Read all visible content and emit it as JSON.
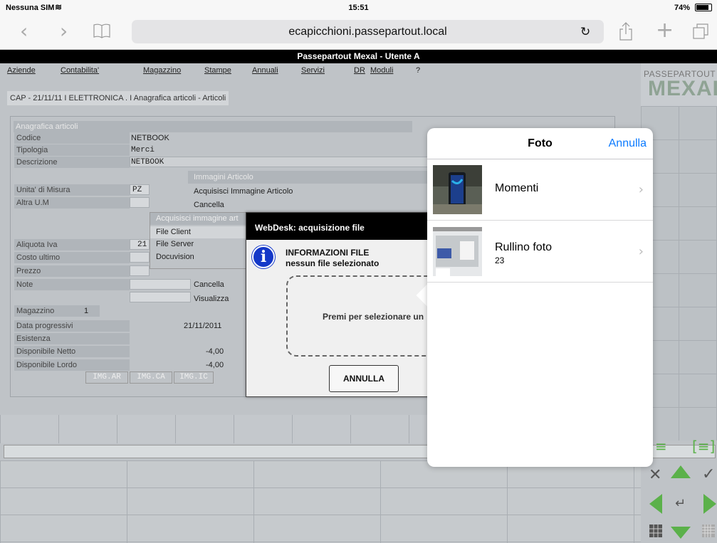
{
  "status": {
    "carrier": "Nessuna SIM",
    "time": "15:51",
    "battery": "74%"
  },
  "safari": {
    "url": "ecapicchioni.passepartout.local"
  },
  "app": {
    "title": "Passepartout Mexal - Utente A",
    "logo_top": "PASSEPARTOUT",
    "logo_bottom": "MEXAL"
  },
  "menu": [
    {
      "label": "Aziende"
    },
    {
      "label": "Contabilita'"
    },
    {
      "label": "Magazzino"
    },
    {
      "label": "Stampe"
    },
    {
      "label": "Annuali"
    },
    {
      "label": "Servizi"
    },
    {
      "label": "DR"
    },
    {
      "label": "Moduli"
    },
    {
      "label": "?"
    }
  ],
  "breadcrumb": "CAP - 21/11/11 I ELETTRONICA . I Anagrafica articoli - Articoli",
  "form": {
    "title": "Anagrafica articoli",
    "codice_label": "Codice",
    "codice": "NETBOOK",
    "tipologia_label": "Tipologia",
    "tipologia": "Merci",
    "descrizione_label": "Descrizione",
    "descrizione": "NETBOOK",
    "um_label": "Unita' di Misura",
    "um": "PZ",
    "altra_um_label": "Altra U.M",
    "aliquota_label": "Aliquota Iva",
    "aliquota": "21",
    "costo_label": "Costo ultimo",
    "prezzo_label": "Prezzo",
    "note_label": "Note",
    "magazzino_label": "Magazzino",
    "magazzino": "1",
    "data_prog_label": "Data progressivi",
    "data_prog": "21/11/2011",
    "esistenza_label": "Esistenza",
    "disp_netto_label": "Disponibile Netto",
    "disp_netto": "-4,00",
    "disp_lordo_label": "Disponibile Lordo",
    "disp_lordo": "-4,00",
    "img_buttons": [
      "IMG.AR",
      "IMG.CA",
      "IMG.IC"
    ]
  },
  "immagini": {
    "title": "Immagini Articolo",
    "acquisisci": "Acquisisci Immagine Articolo",
    "cancella": "Cancella",
    "cancella2": "Cancella",
    "visualizza": "Visualizza"
  },
  "submenu": {
    "title": "Acquisisci immagine art",
    "items": [
      "File Client",
      "File Server",
      "Docuvision"
    ]
  },
  "webdesk": {
    "title": "WebDesk: acquisizione file",
    "info1": "INFORMAZIONI FILE",
    "info2": "nessun file selezionato",
    "drop": "Premi per selezionare un",
    "cancel": "ANNULLA"
  },
  "popover": {
    "title": "Foto",
    "cancel": "Annulla",
    "albums": [
      {
        "name": "Momenti",
        "count": ""
      },
      {
        "name": "Rullino foto",
        "count": "23"
      }
    ]
  }
}
